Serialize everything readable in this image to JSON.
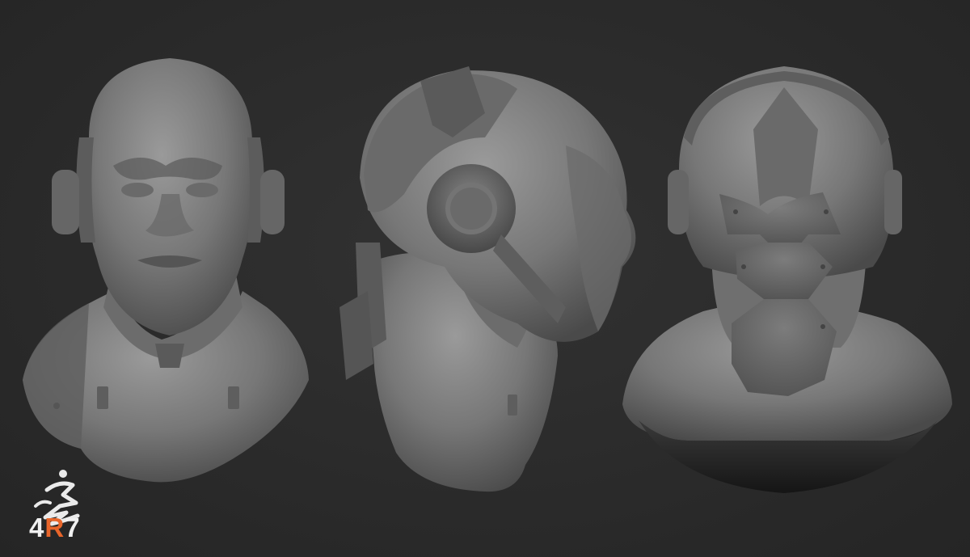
{
  "image": {
    "background_color": "#2b2b2b",
    "clay_color": "#7a7a7a",
    "views": [
      "front-view",
      "side-view",
      "back-view"
    ]
  },
  "logo": {
    "brand_icon": "zbrush-runner-icon",
    "text_prefix": "4",
    "text_accent": "R",
    "text_suffix": "7",
    "accent_color": "#e8652a"
  }
}
